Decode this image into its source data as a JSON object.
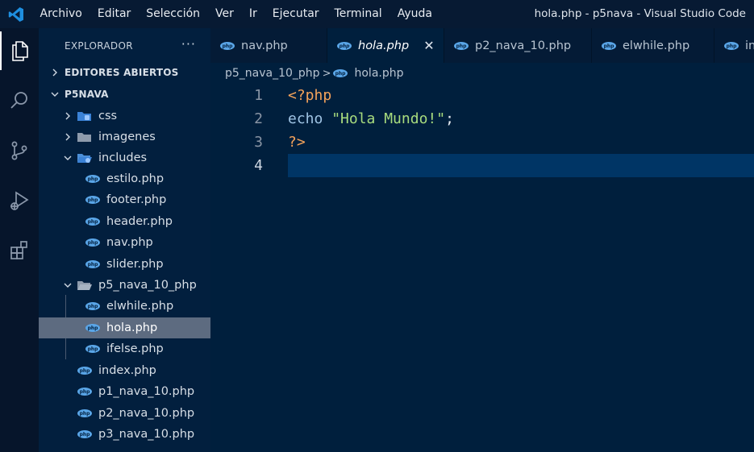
{
  "window": {
    "title": "hola.php - p5nava - Visual Studio Code"
  },
  "menu": [
    "Archivo",
    "Editar",
    "Selección",
    "Ver",
    "Ir",
    "Ejecutar",
    "Terminal",
    "Ayuda"
  ],
  "activity_bar": [
    {
      "icon": "files-icon",
      "active": true
    },
    {
      "icon": "search-icon",
      "active": false
    },
    {
      "icon": "source-control-icon",
      "active": false
    },
    {
      "icon": "run-debug-icon",
      "active": false
    },
    {
      "icon": "extensions-icon",
      "active": false
    }
  ],
  "explorer": {
    "title": "EXPLORADOR",
    "more": "···",
    "open_editors": "EDITORES ABIERTOS",
    "project": "P5NAVA",
    "items": {
      "css": "css",
      "imagenes": "imagenes",
      "includes": "includes",
      "estilo": "estilo.php",
      "footer": "footer.php",
      "header": "header.php",
      "nav": "nav.php",
      "slider": "slider.php",
      "p5folder": "p5_nava_10_php",
      "elwhile": "elwhile.php",
      "hola": "hola.php",
      "ifelse": "ifelse.php",
      "index": "index.php",
      "p1": "p1_nava_10.php",
      "p2": "p2_nava_10.php",
      "p3": "p3_nava_10.php"
    }
  },
  "tabs": [
    {
      "label": "nav.php",
      "active": false
    },
    {
      "label": "hola.php",
      "active": true
    },
    {
      "label": "p2_nava_10.php",
      "active": false
    },
    {
      "label": "elwhile.php",
      "active": false
    },
    {
      "label": "in",
      "active": false
    }
  ],
  "tab_close": "✕",
  "breadcrumb": {
    "folder": "p5_nava_10_php",
    "separator": ">",
    "file": "hola.php"
  },
  "editor": {
    "line_numbers": [
      "1",
      "2",
      "3",
      "4"
    ],
    "line1": "<?php",
    "line2_kw": "echo",
    "line2_str": "\"Hola Mundo!\"",
    "line2_end": ";",
    "line3": "?>",
    "current_line": 4
  },
  "colors": {
    "accent_vscode_blue": "#1e8fe0",
    "php_icon": "#5aa6e8",
    "string": "#a8dc7e",
    "php_tag": "#f5a35a"
  }
}
